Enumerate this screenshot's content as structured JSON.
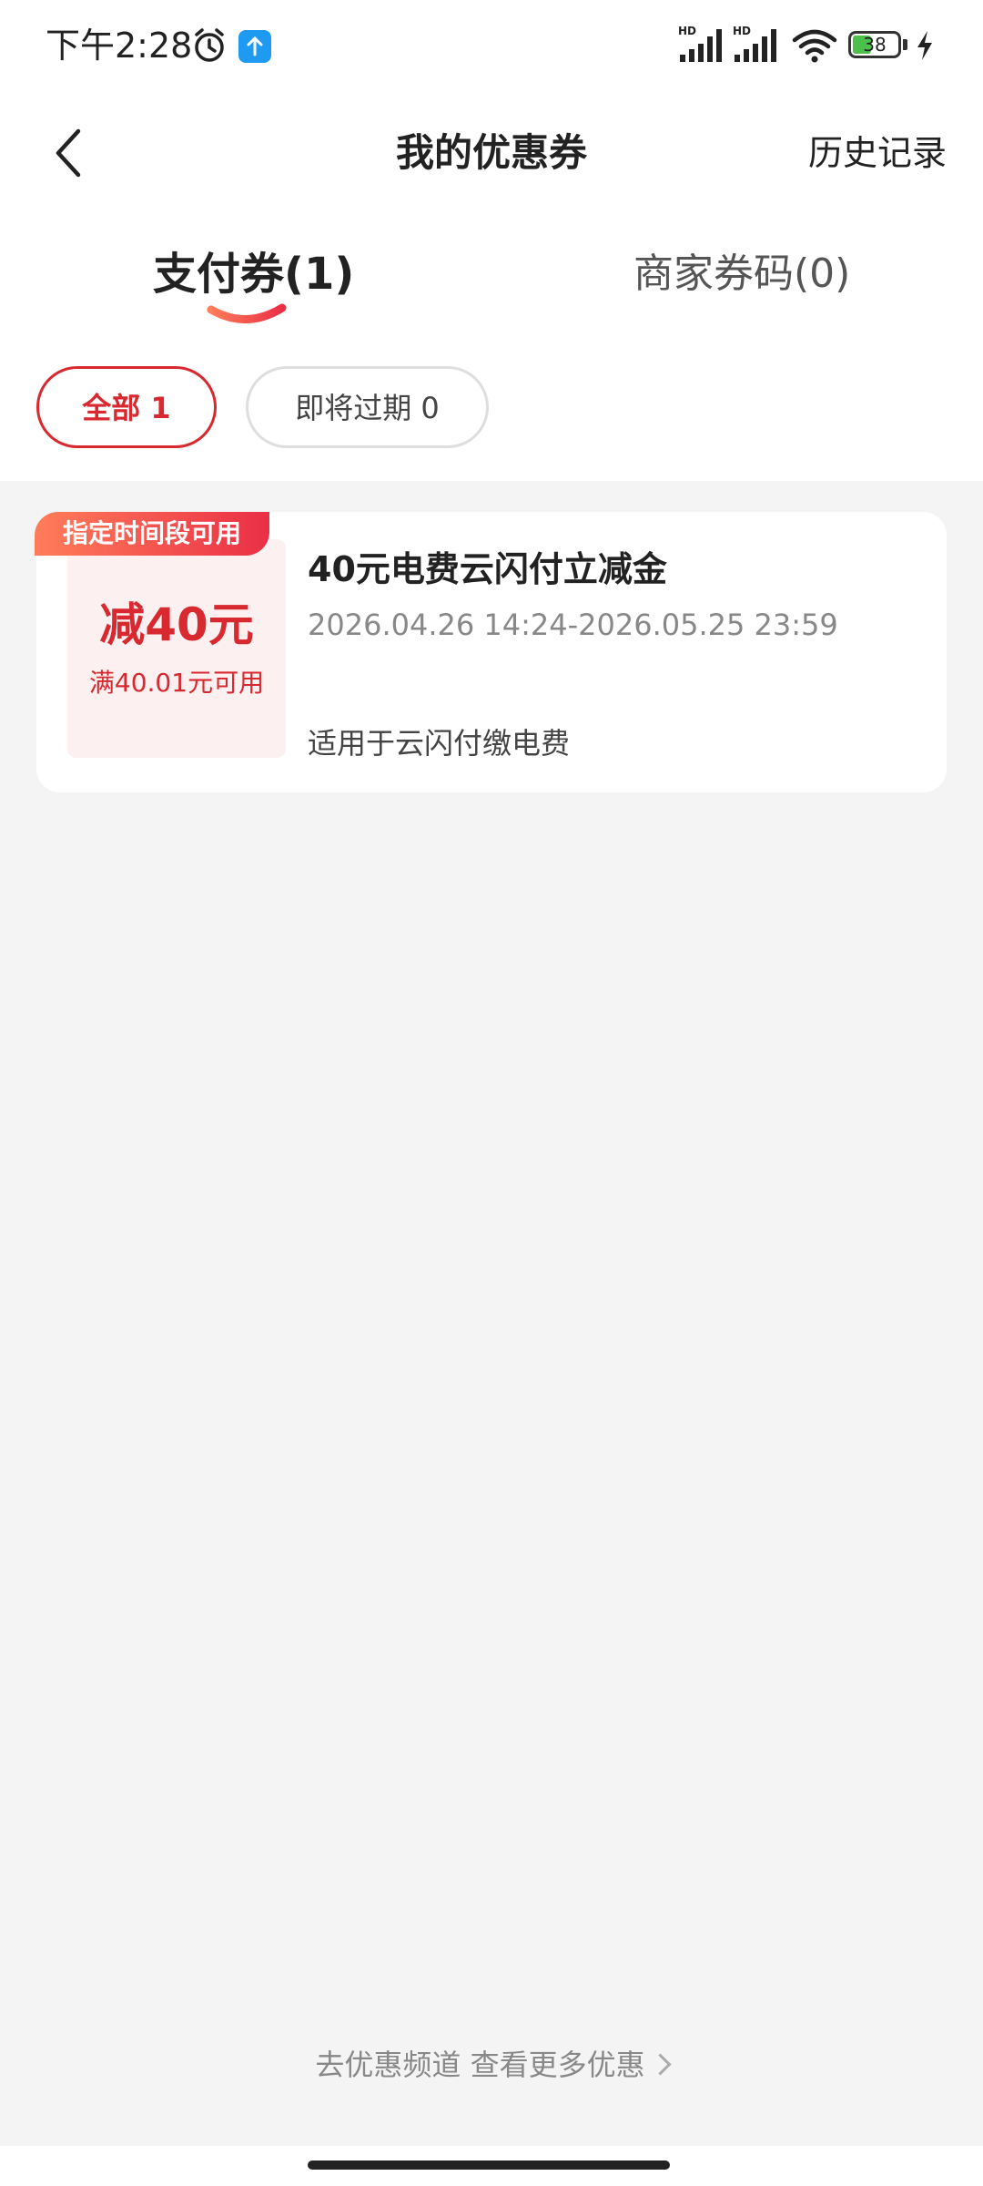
{
  "status_bar": {
    "time": "下午2:28",
    "battery_level": "38",
    "signal_label": "HD",
    "icons": [
      "alarm-icon",
      "upload-icon",
      "signal-icon",
      "wifi-icon",
      "battery-icon",
      "charging-icon"
    ]
  },
  "header": {
    "title": "我的优惠券",
    "history_label": "历史记录"
  },
  "tabs": [
    {
      "label": "支付券(1)",
      "active": true
    },
    {
      "label": "商家券码(0)",
      "active": false
    }
  ],
  "filters": [
    {
      "label": "全部 1",
      "active": true
    },
    {
      "label": "即将过期 0",
      "active": false
    }
  ],
  "coupons": [
    {
      "tag": "指定时间段可用",
      "amount": "减40元",
      "threshold": "满40.01元可用",
      "title": "40元电费云闪付立减金",
      "period": "2026.04.26 14:24-2026.05.25 23:59",
      "scope": "适用于云闪付缴电费"
    }
  ],
  "footer": {
    "link_label": "去优惠频道 查看更多优惠"
  },
  "colors": {
    "accent": "#d7292f",
    "tag_gradient_start": "#ff7d5a",
    "tag_gradient_end": "#ea2f46",
    "background": "#f4f4f4"
  }
}
